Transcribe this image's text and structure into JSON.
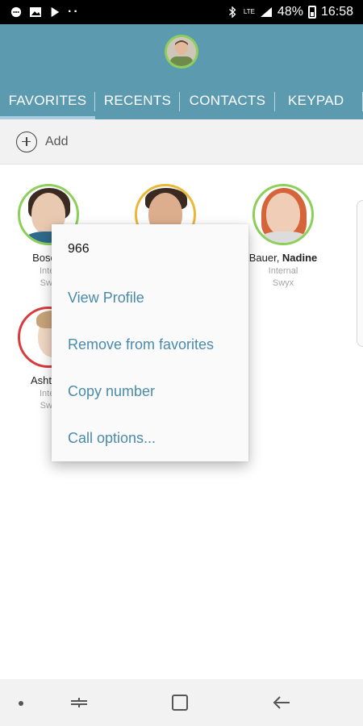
{
  "status_bar": {
    "battery": "48%",
    "time": "16:58",
    "network": "LTE"
  },
  "tabs": [
    {
      "label": "FAVORITES"
    },
    {
      "label": "RECENTS"
    },
    {
      "label": "CONTACTS"
    },
    {
      "label": "KEYPAD"
    }
  ],
  "active_tab": "FAVORITES",
  "add_bar": {
    "label": "Add"
  },
  "favorites": [
    {
      "last": "Bosch, ",
      "first": "",
      "sub1": "Inter",
      "sub2": "Swy",
      "status_color": "#8ccf5a"
    },
    {
      "last": "",
      "first": "",
      "sub1": "",
      "sub2": "",
      "status_color": "#eab838"
    },
    {
      "last": "Bauer, ",
      "first": "Nadine",
      "sub1": "Internal",
      "sub2": "Swyx",
      "status_color": "#8ccf5a"
    },
    {
      "last": "Ashton, ",
      "first": "",
      "sub1": "Inter",
      "sub2": "Swy",
      "status_color": "#d83b3b"
    }
  ],
  "context_menu": {
    "header": "966",
    "items": [
      {
        "label": "View Profile"
      },
      {
        "label": "Remove from favorites"
      },
      {
        "label": "Copy number"
      },
      {
        "label": "Call options..."
      }
    ]
  },
  "colors": {
    "header": "#5b9aaf",
    "menu_item": "#4a8bab",
    "presence_available": "#8ccf5a",
    "presence_away": "#eab838",
    "presence_busy": "#d83b3b"
  }
}
